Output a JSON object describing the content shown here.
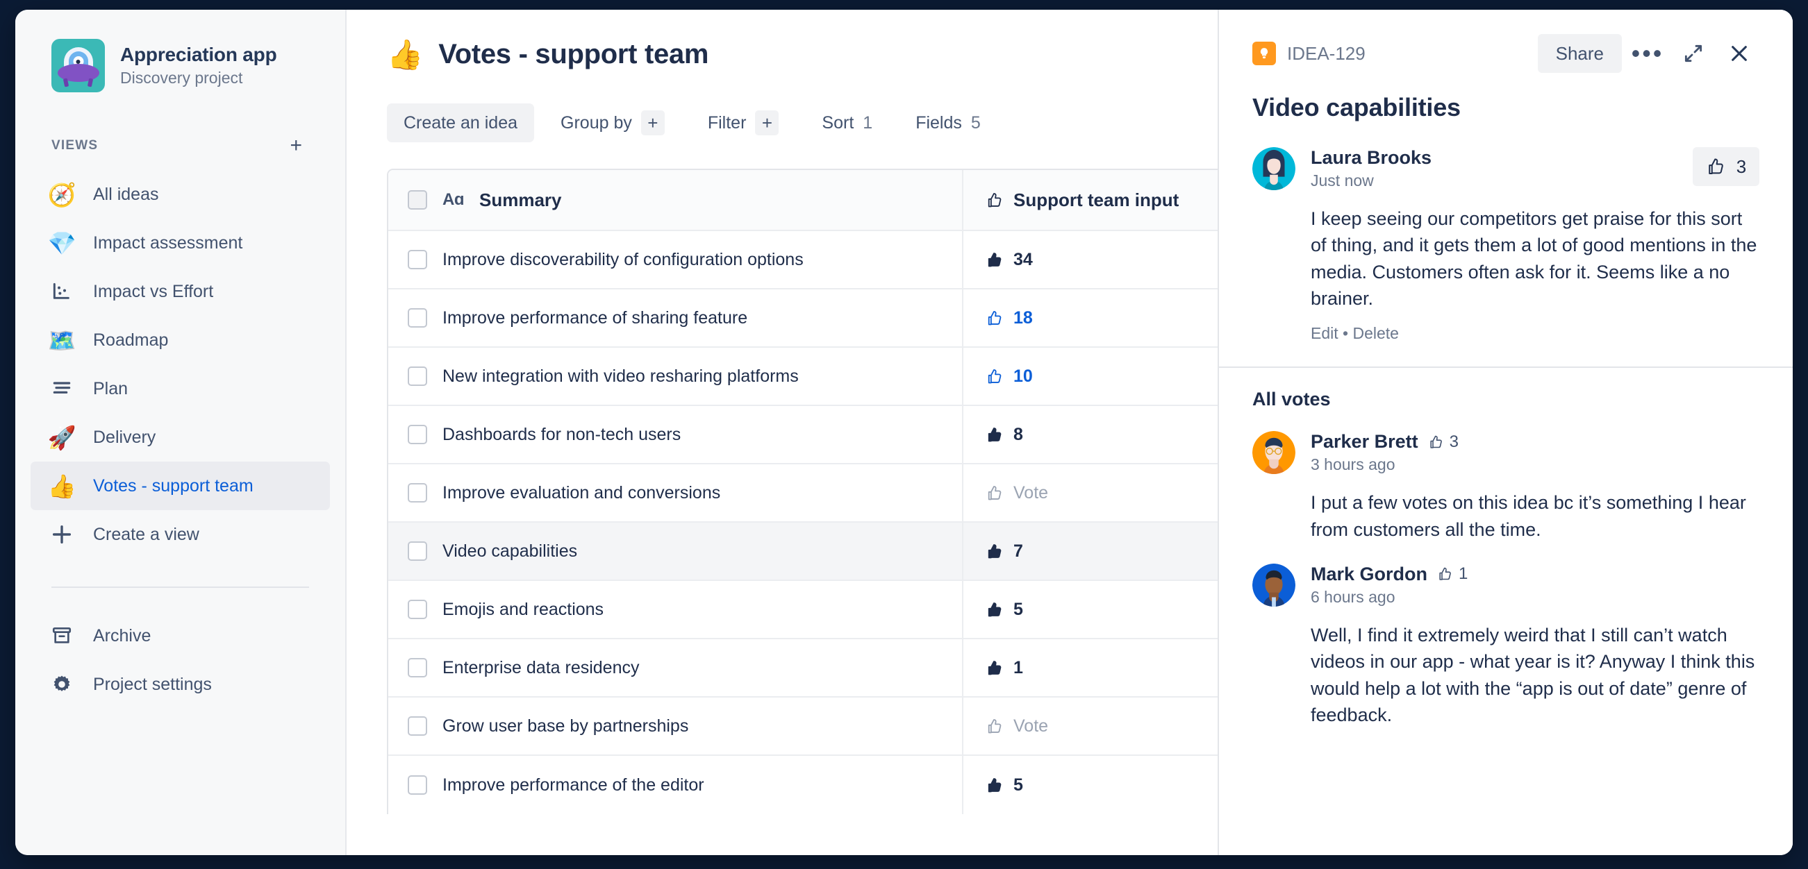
{
  "sidebar": {
    "project": {
      "name": "Appreciation app",
      "subtitle": "Discovery project",
      "icon": "ufo-avatar"
    },
    "views_label": "VIEWS",
    "add_view_icon": "+",
    "items": [
      {
        "label": "All ideas",
        "emoji": "🧭",
        "icon": "compass-icon",
        "selected": false
      },
      {
        "label": "Impact assessment",
        "emoji": "💎",
        "icon": "diamond-icon",
        "selected": false
      },
      {
        "label": "Impact vs Effort",
        "emoji": "",
        "icon": "scatter-chart-icon",
        "selected": false
      },
      {
        "label": "Roadmap",
        "emoji": "🗺️",
        "icon": "map-icon",
        "selected": false
      },
      {
        "label": "Plan",
        "emoji": "",
        "icon": "list-lines-icon",
        "selected": false
      },
      {
        "label": "Delivery",
        "emoji": "🚀",
        "icon": "rocket-icon",
        "selected": false
      },
      {
        "label": "Votes - support team",
        "emoji": "👍",
        "icon": "thumbs-up-icon",
        "selected": true
      },
      {
        "label": "Create a view",
        "emoji": "",
        "icon": "plus-icon",
        "selected": false
      }
    ],
    "bottom_items": [
      {
        "label": "Archive",
        "icon": "archive-box-icon"
      },
      {
        "label": "Project settings",
        "icon": "gear-icon"
      }
    ]
  },
  "main": {
    "view_emoji": "👍",
    "view_title": "Votes - support team",
    "toolbar": {
      "create_label": "Create an idea",
      "group_by_label": "Group by",
      "group_by_chip": "+",
      "filter_label": "Filter",
      "filter_chip": "+",
      "sort_label": "Sort",
      "sort_count": "1",
      "fields_label": "Fields",
      "fields_count": "5"
    },
    "table": {
      "columns": [
        {
          "label": "Summary",
          "prefix": "Aɑ",
          "icon": "text-field-icon"
        },
        {
          "label": "Support team input",
          "icon": "thumbs-up-icon"
        }
      ],
      "rows": [
        {
          "summary": "Improve discoverability of configuration options",
          "votes": "34",
          "state": "normal",
          "selected": false
        },
        {
          "summary": "Improve performance of sharing feature",
          "votes": "18",
          "state": "voted",
          "selected": false
        },
        {
          "summary": "New integration with video resharing platforms",
          "votes": "10",
          "state": "voted",
          "selected": false
        },
        {
          "summary": "Dashboards for non-tech users",
          "votes": "8",
          "state": "normal",
          "selected": false
        },
        {
          "summary": "Improve evaluation and conversions",
          "votes": "Vote",
          "state": "empty",
          "selected": false
        },
        {
          "summary": "Video capabilities",
          "votes": "7",
          "state": "normal",
          "selected": true
        },
        {
          "summary": "Emojis and reactions",
          "votes": "5",
          "state": "normal",
          "selected": false
        },
        {
          "summary": "Enterprise data residency",
          "votes": "1",
          "state": "normal",
          "selected": false
        },
        {
          "summary": "Grow user base by partnerships",
          "votes": "Vote",
          "state": "empty",
          "selected": false
        },
        {
          "summary": "Improve performance of the editor",
          "votes": "5",
          "state": "normal",
          "selected": false
        }
      ]
    }
  },
  "panel": {
    "idea_key": "IDEA-129",
    "key_icon": "lightbulb-icon",
    "share_label": "Share",
    "more_icon": "ellipsis-icon",
    "expand_icon": "expand-icon",
    "close_icon": "close-icon",
    "title": "Video capabilities",
    "top_comment": {
      "author": "Laura Brooks",
      "time": "Just now",
      "like_count": "3",
      "body": "I keep seeing our competitors get praise for this sort of thing, and it gets them a lot of good mentions in the media. Customers often ask for it. Seems like a no brainer.",
      "edit_label": "Edit",
      "separator": "•",
      "delete_label": "Delete",
      "avatar": "laura-avatar"
    },
    "all_votes_label": "All votes",
    "votes": [
      {
        "author": "Parker Brett",
        "count": "3",
        "time": "3 hours ago",
        "body": "I put a few votes on this idea bc it’s something I hear from customers all the time.",
        "avatar": "parker-avatar"
      },
      {
        "author": "Mark Gordon",
        "count": "1",
        "time": "6 hours ago",
        "body": "Well, I find it extremely weird that I still can’t watch videos in our app - what year is it? Anyway I think this would help a lot with the “app is out of date” genre of feedback.",
        "avatar": "mark-avatar"
      }
    ]
  },
  "colors": {
    "accent_blue": "#0b5ed7",
    "brand_teal": "#3bb9b6",
    "badge_orange": "#ff991f",
    "text_dark": "#1f2d4a",
    "text_muted": "#6b778c"
  }
}
